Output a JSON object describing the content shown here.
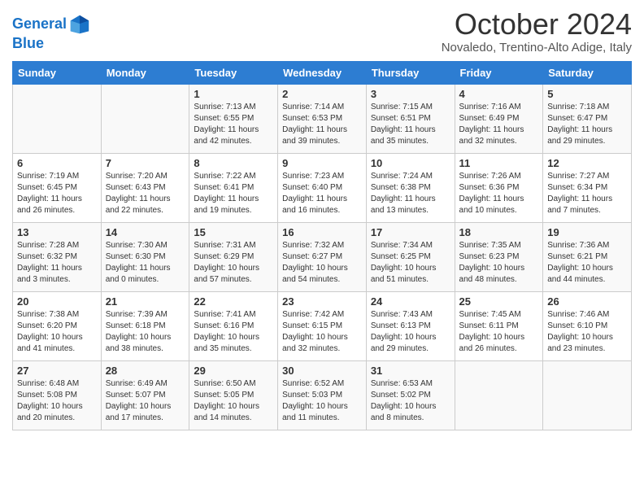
{
  "logo": {
    "line1": "General",
    "line2": "Blue"
  },
  "title": "October 2024",
  "subtitle": "Novaledo, Trentino-Alto Adige, Italy",
  "days_of_week": [
    "Sunday",
    "Monday",
    "Tuesday",
    "Wednesday",
    "Thursday",
    "Friday",
    "Saturday"
  ],
  "weeks": [
    [
      {
        "day": "",
        "sunrise": "",
        "sunset": "",
        "daylight": ""
      },
      {
        "day": "",
        "sunrise": "",
        "sunset": "",
        "daylight": ""
      },
      {
        "day": "1",
        "sunrise": "Sunrise: 7:13 AM",
        "sunset": "Sunset: 6:55 PM",
        "daylight": "Daylight: 11 hours and 42 minutes."
      },
      {
        "day": "2",
        "sunrise": "Sunrise: 7:14 AM",
        "sunset": "Sunset: 6:53 PM",
        "daylight": "Daylight: 11 hours and 39 minutes."
      },
      {
        "day": "3",
        "sunrise": "Sunrise: 7:15 AM",
        "sunset": "Sunset: 6:51 PM",
        "daylight": "Daylight: 11 hours and 35 minutes."
      },
      {
        "day": "4",
        "sunrise": "Sunrise: 7:16 AM",
        "sunset": "Sunset: 6:49 PM",
        "daylight": "Daylight: 11 hours and 32 minutes."
      },
      {
        "day": "5",
        "sunrise": "Sunrise: 7:18 AM",
        "sunset": "Sunset: 6:47 PM",
        "daylight": "Daylight: 11 hours and 29 minutes."
      }
    ],
    [
      {
        "day": "6",
        "sunrise": "Sunrise: 7:19 AM",
        "sunset": "Sunset: 6:45 PM",
        "daylight": "Daylight: 11 hours and 26 minutes."
      },
      {
        "day": "7",
        "sunrise": "Sunrise: 7:20 AM",
        "sunset": "Sunset: 6:43 PM",
        "daylight": "Daylight: 11 hours and 22 minutes."
      },
      {
        "day": "8",
        "sunrise": "Sunrise: 7:22 AM",
        "sunset": "Sunset: 6:41 PM",
        "daylight": "Daylight: 11 hours and 19 minutes."
      },
      {
        "day": "9",
        "sunrise": "Sunrise: 7:23 AM",
        "sunset": "Sunset: 6:40 PM",
        "daylight": "Daylight: 11 hours and 16 minutes."
      },
      {
        "day": "10",
        "sunrise": "Sunrise: 7:24 AM",
        "sunset": "Sunset: 6:38 PM",
        "daylight": "Daylight: 11 hours and 13 minutes."
      },
      {
        "day": "11",
        "sunrise": "Sunrise: 7:26 AM",
        "sunset": "Sunset: 6:36 PM",
        "daylight": "Daylight: 11 hours and 10 minutes."
      },
      {
        "day": "12",
        "sunrise": "Sunrise: 7:27 AM",
        "sunset": "Sunset: 6:34 PM",
        "daylight": "Daylight: 11 hours and 7 minutes."
      }
    ],
    [
      {
        "day": "13",
        "sunrise": "Sunrise: 7:28 AM",
        "sunset": "Sunset: 6:32 PM",
        "daylight": "Daylight: 11 hours and 3 minutes."
      },
      {
        "day": "14",
        "sunrise": "Sunrise: 7:30 AM",
        "sunset": "Sunset: 6:30 PM",
        "daylight": "Daylight: 11 hours and 0 minutes."
      },
      {
        "day": "15",
        "sunrise": "Sunrise: 7:31 AM",
        "sunset": "Sunset: 6:29 PM",
        "daylight": "Daylight: 10 hours and 57 minutes."
      },
      {
        "day": "16",
        "sunrise": "Sunrise: 7:32 AM",
        "sunset": "Sunset: 6:27 PM",
        "daylight": "Daylight: 10 hours and 54 minutes."
      },
      {
        "day": "17",
        "sunrise": "Sunrise: 7:34 AM",
        "sunset": "Sunset: 6:25 PM",
        "daylight": "Daylight: 10 hours and 51 minutes."
      },
      {
        "day": "18",
        "sunrise": "Sunrise: 7:35 AM",
        "sunset": "Sunset: 6:23 PM",
        "daylight": "Daylight: 10 hours and 48 minutes."
      },
      {
        "day": "19",
        "sunrise": "Sunrise: 7:36 AM",
        "sunset": "Sunset: 6:21 PM",
        "daylight": "Daylight: 10 hours and 44 minutes."
      }
    ],
    [
      {
        "day": "20",
        "sunrise": "Sunrise: 7:38 AM",
        "sunset": "Sunset: 6:20 PM",
        "daylight": "Daylight: 10 hours and 41 minutes."
      },
      {
        "day": "21",
        "sunrise": "Sunrise: 7:39 AM",
        "sunset": "Sunset: 6:18 PM",
        "daylight": "Daylight: 10 hours and 38 minutes."
      },
      {
        "day": "22",
        "sunrise": "Sunrise: 7:41 AM",
        "sunset": "Sunset: 6:16 PM",
        "daylight": "Daylight: 10 hours and 35 minutes."
      },
      {
        "day": "23",
        "sunrise": "Sunrise: 7:42 AM",
        "sunset": "Sunset: 6:15 PM",
        "daylight": "Daylight: 10 hours and 32 minutes."
      },
      {
        "day": "24",
        "sunrise": "Sunrise: 7:43 AM",
        "sunset": "Sunset: 6:13 PM",
        "daylight": "Daylight: 10 hours and 29 minutes."
      },
      {
        "day": "25",
        "sunrise": "Sunrise: 7:45 AM",
        "sunset": "Sunset: 6:11 PM",
        "daylight": "Daylight: 10 hours and 26 minutes."
      },
      {
        "day": "26",
        "sunrise": "Sunrise: 7:46 AM",
        "sunset": "Sunset: 6:10 PM",
        "daylight": "Daylight: 10 hours and 23 minutes."
      }
    ],
    [
      {
        "day": "27",
        "sunrise": "Sunrise: 6:48 AM",
        "sunset": "Sunset: 5:08 PM",
        "daylight": "Daylight: 10 hours and 20 minutes."
      },
      {
        "day": "28",
        "sunrise": "Sunrise: 6:49 AM",
        "sunset": "Sunset: 5:07 PM",
        "daylight": "Daylight: 10 hours and 17 minutes."
      },
      {
        "day": "29",
        "sunrise": "Sunrise: 6:50 AM",
        "sunset": "Sunset: 5:05 PM",
        "daylight": "Daylight: 10 hours and 14 minutes."
      },
      {
        "day": "30",
        "sunrise": "Sunrise: 6:52 AM",
        "sunset": "Sunset: 5:03 PM",
        "daylight": "Daylight: 10 hours and 11 minutes."
      },
      {
        "day": "31",
        "sunrise": "Sunrise: 6:53 AM",
        "sunset": "Sunset: 5:02 PM",
        "daylight": "Daylight: 10 hours and 8 minutes."
      },
      {
        "day": "",
        "sunrise": "",
        "sunset": "",
        "daylight": ""
      },
      {
        "day": "",
        "sunrise": "",
        "sunset": "",
        "daylight": ""
      }
    ]
  ]
}
